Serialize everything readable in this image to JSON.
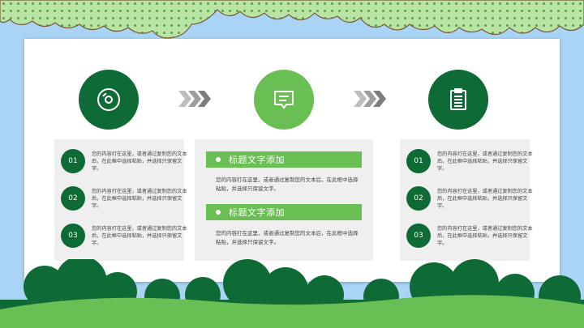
{
  "colors": {
    "dark_green": "#0f6b35",
    "light_green": "#6abf54",
    "sky": "#a9d4f5",
    "panel": "#efefef"
  },
  "icons": {
    "left": "disc-icon",
    "middle": "chat-bubble-icon",
    "right": "clipboard-icon",
    "arrows": "chevrons-right-icon"
  },
  "left_panel": {
    "items": [
      {
        "num": "01",
        "text": "您的内容打在这里，或者通过复制您的文本后，在此框中选择粘贴，并选择只保留文字。"
      },
      {
        "num": "02",
        "text": "您的内容打在这里，或者通过复制您的文本后，在此框中选择粘贴，并选择只保留文字。"
      },
      {
        "num": "03",
        "text": "您的内容打在这里，或者通过复制您的文本后，在此框中选择粘贴，并选择只保留文字。"
      }
    ]
  },
  "middle_panel": {
    "sections": [
      {
        "title": "标题文字添加",
        "text": "您的内容打在这里，或者通过复制您的文本后，在此框中选择粘贴，并选择只保留文字。"
      },
      {
        "title": "标题文字添加",
        "text": "您的内容打在这里，或者通过复制您的文本后，在此框中选择粘贴，并选择只保留文字。"
      }
    ]
  },
  "right_panel": {
    "items": [
      {
        "num": "01",
        "text": "您的内容打在这里，或者通过复制您的文本后，在此框中选择粘贴，并选择只保留文字。"
      },
      {
        "num": "02",
        "text": "您的内容打在这里，或者通过复制您的文本后，在此框中选择粘贴，并选择只保留文字。"
      },
      {
        "num": "03",
        "text": "您的内容打在这里，或者通过复制您的文本后，在此框中选择粘贴，并选择只保留文字。"
      }
    ]
  }
}
